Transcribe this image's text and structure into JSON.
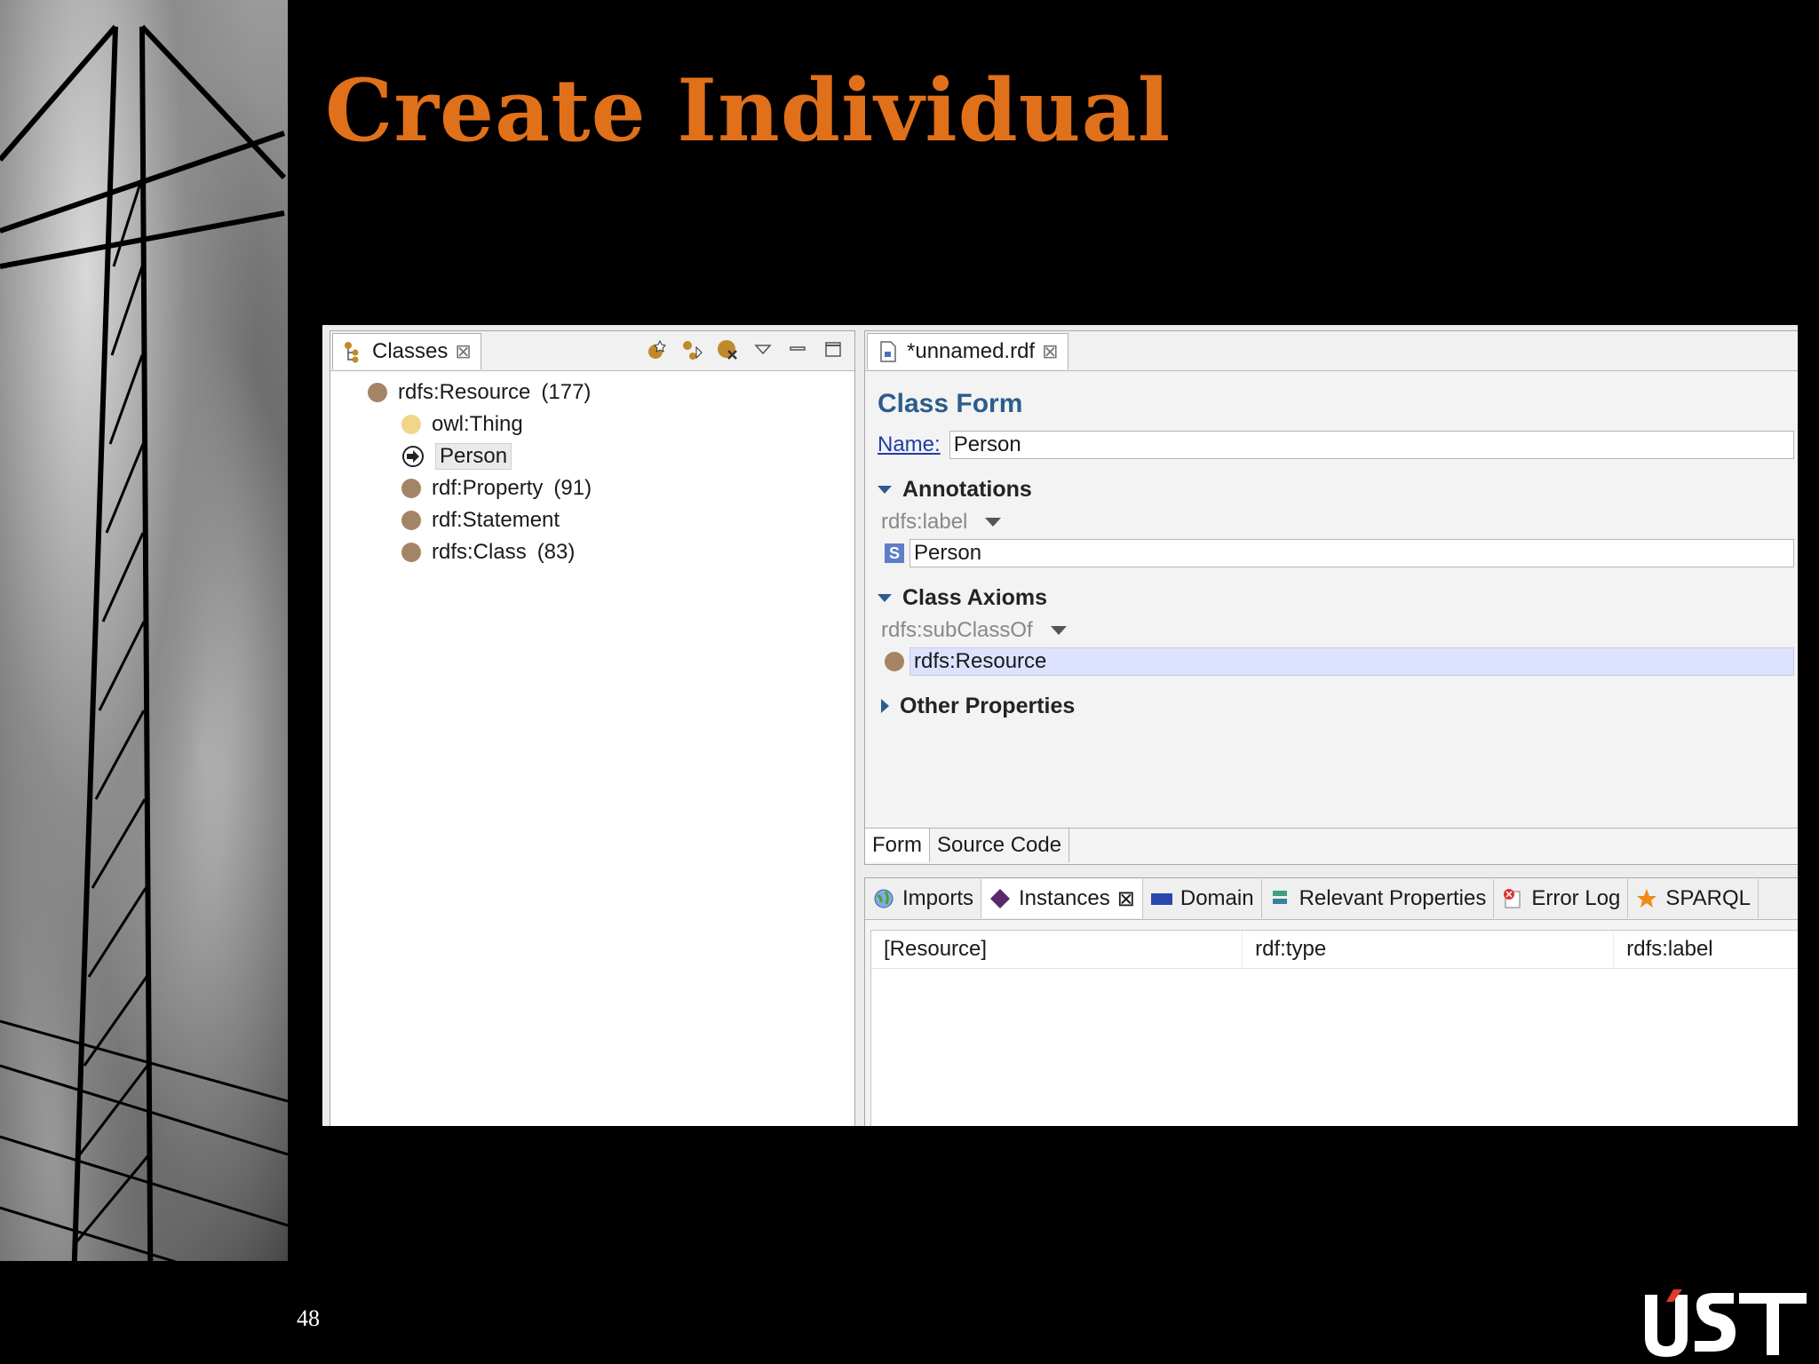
{
  "slide": {
    "title": "Create Individual",
    "page_number": "48",
    "logo_text": "UST"
  },
  "left_panel": {
    "tab_label": "Classes",
    "tree": [
      {
        "label": "rdfs:Resource",
        "count": "(177)"
      },
      {
        "label": "owl:Thing",
        "count": ""
      },
      {
        "label": "Person",
        "count": ""
      },
      {
        "label": "rdf:Property",
        "count": "(91)"
      },
      {
        "label": "rdf:Statement",
        "count": ""
      },
      {
        "label": "rdfs:Class",
        "count": "(83)"
      }
    ]
  },
  "editor": {
    "tab_label": "*unnamed.rdf",
    "form_title": "Class Form",
    "name_label": "Name:",
    "name_value": "Person",
    "annotations_label": "Annotations",
    "rdfs_label_prop": "rdfs:label",
    "rdfs_label_value": "Person",
    "s_icon": "S",
    "axioms_label": "Class Axioms",
    "subclass_prop": "rdfs:subClassOf",
    "subclass_value": "rdfs:Resource",
    "other_label": "Other Properties",
    "subtabs": [
      "Form",
      "Source Code"
    ]
  },
  "bottom_panel": {
    "tabs": [
      "Imports",
      "Instances",
      "Domain",
      "Relevant Properties",
      "Error Log",
      "SPARQL"
    ],
    "columns": [
      "[Resource]",
      "rdf:type",
      "rdfs:label"
    ]
  },
  "colors": {
    "title": "#e0701a",
    "form_title": "#2b5d8c",
    "class_dot": "#a58465",
    "owl_dot": "#f0d58a",
    "highlight": "#dde2ff"
  }
}
